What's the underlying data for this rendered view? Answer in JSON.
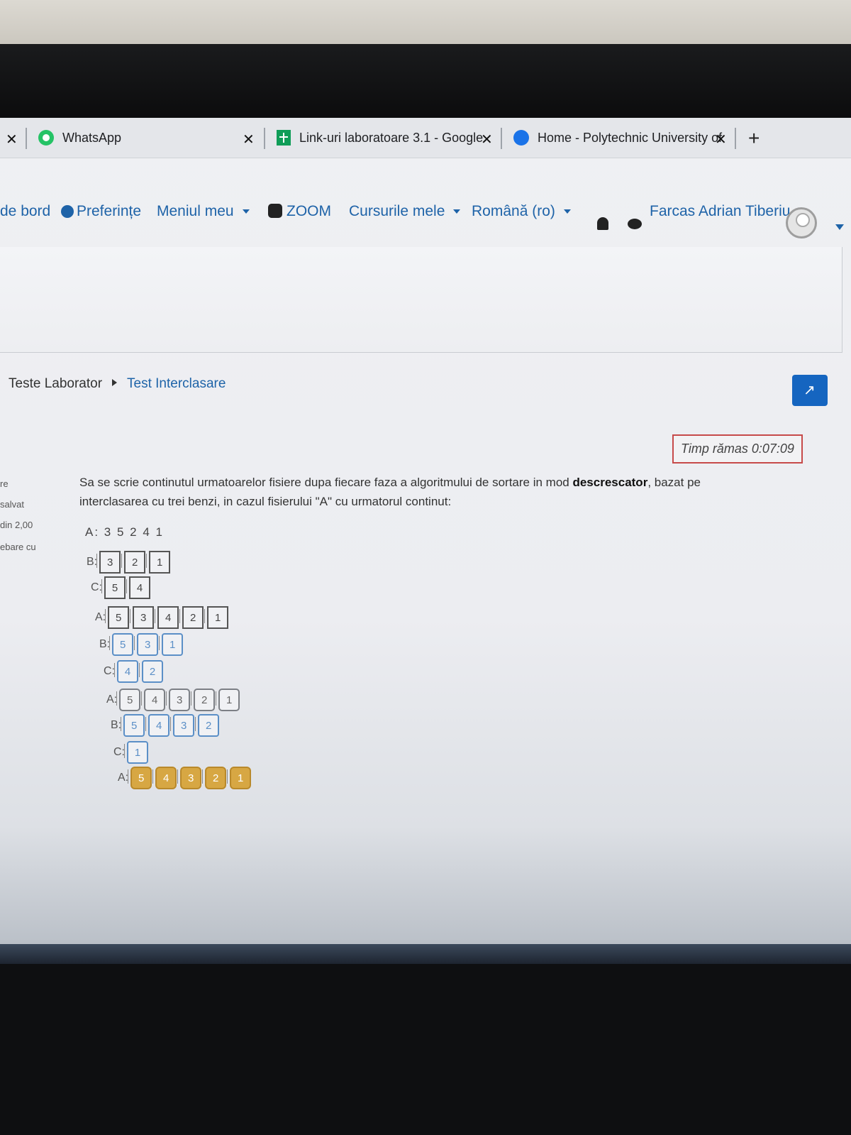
{
  "tabs": [
    {
      "label": "WhatsApp"
    },
    {
      "label": "Link-uri laboratoare 3.1 - Google"
    },
    {
      "label": "Home - Polytechnic University of"
    }
  ],
  "nav": {
    "dashboard": "de bord",
    "preferences": "Preferințe",
    "my_menu": "Meniul meu",
    "zoom": "ZOOM",
    "my_courses": "Cursurile mele",
    "language": "Română (ro)",
    "user": "Farcas Adrian Tiberiu"
  },
  "breadcrumb": {
    "parent": "Teste Laborator",
    "current": "Test Interclasare"
  },
  "timer": "Timp rămas 0:07:09",
  "side_info": [
    "re",
    "salvat",
    "din 2,00",
    "ebare cu"
  ],
  "question": {
    "text_1": "Sa se scrie continutul urmatoarelor fisiere dupa fiecare faza a algoritmului de sortare in mod ",
    "bold": "descrescator",
    "text_2": ", bazat pe interclasarea cu trei benzi, in cazul fisierului \"A\" cu urmatorul continut:",
    "initial": "A: 3 5 2 4 1"
  },
  "rows": [
    {
      "label": "B:",
      "values": [
        "3",
        "2",
        "1"
      ]
    },
    {
      "label": "C:",
      "values": [
        "5",
        "4"
      ]
    },
    {
      "label": "A:",
      "values": [
        "5",
        "3",
        "4",
        "2",
        "1"
      ]
    },
    {
      "label": "B:",
      "values": [
        "5",
        "3",
        "1"
      ]
    },
    {
      "label": "C:",
      "values": [
        "4",
        "2"
      ]
    },
    {
      "label": "A:",
      "values": [
        "5",
        "4",
        "3",
        "2",
        "1"
      ]
    },
    {
      "label": "B:",
      "values": [
        "5",
        "4",
        "3",
        "2"
      ]
    },
    {
      "label": "C:",
      "values": [
        "1"
      ]
    },
    {
      "label": "A:",
      "values": [
        "5",
        "4",
        "3",
        "2",
        "1"
      ]
    }
  ],
  "colors": {
    "link": "#1e63a8",
    "timer_border": "#c74a4a",
    "expand_button": "#1565c0",
    "final_row": "#d7a743"
  }
}
